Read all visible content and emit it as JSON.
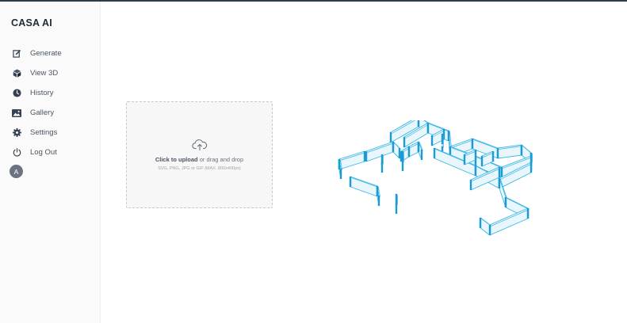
{
  "app": {
    "brand": "CASA AI"
  },
  "sidebar": {
    "items": [
      {
        "label": "Generate",
        "icon": "edit-icon"
      },
      {
        "label": "View 3D",
        "icon": "cube-icon"
      },
      {
        "label": "History",
        "icon": "clock-icon"
      },
      {
        "label": "Gallery",
        "icon": "image-icon"
      },
      {
        "label": "Settings",
        "icon": "gear-icon"
      },
      {
        "label": "Log Out",
        "icon": "power-icon"
      }
    ],
    "avatar_initial": "A"
  },
  "upload": {
    "click_text": "Click to upload",
    "drag_text": " or drag and drop",
    "hint": "SVG, PNG, JPG or GIF (MAX. 800x400px)"
  },
  "colors": {
    "wall_stroke": "#36b6e6",
    "wall_fill": "#e9f7fd",
    "wall_dark": "#1a9bd4",
    "sidebar_bg": "#fafafa",
    "topline": "#2f3a4a"
  }
}
